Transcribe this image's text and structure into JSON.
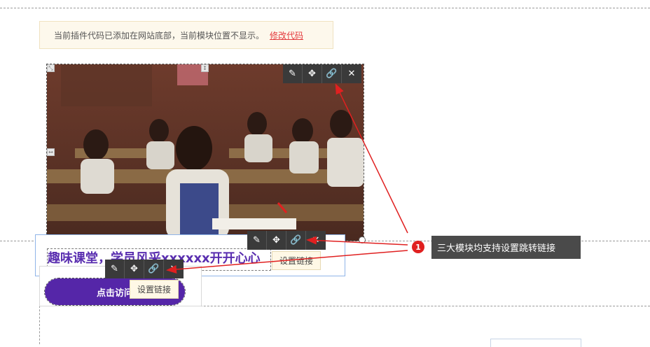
{
  "notice": {
    "text": "当前插件代码已添加在网站底部，当前模块位置不显示。",
    "link": "修改代码"
  },
  "toolbar_icons": [
    "pencil-icon",
    "move-icon",
    "link-icon",
    "close-icon"
  ],
  "toolbar_glyphs": {
    "edit": "✎",
    "move": "✥",
    "link": "🔗",
    "close": "✕"
  },
  "title_module": {
    "text": "趣味课堂，学员风采xxxxxx开开心心",
    "link_tip": "设置链接"
  },
  "button_module": {
    "label": "点击访问",
    "link_tip": "设置链接"
  },
  "annotation": {
    "badge": "1",
    "text": "三大模块均支持设置跳转链接"
  },
  "colors": {
    "accent_purple": "#5526a8",
    "annotation_red": "#e02020",
    "notice_bg": "#fdf8ec"
  }
}
